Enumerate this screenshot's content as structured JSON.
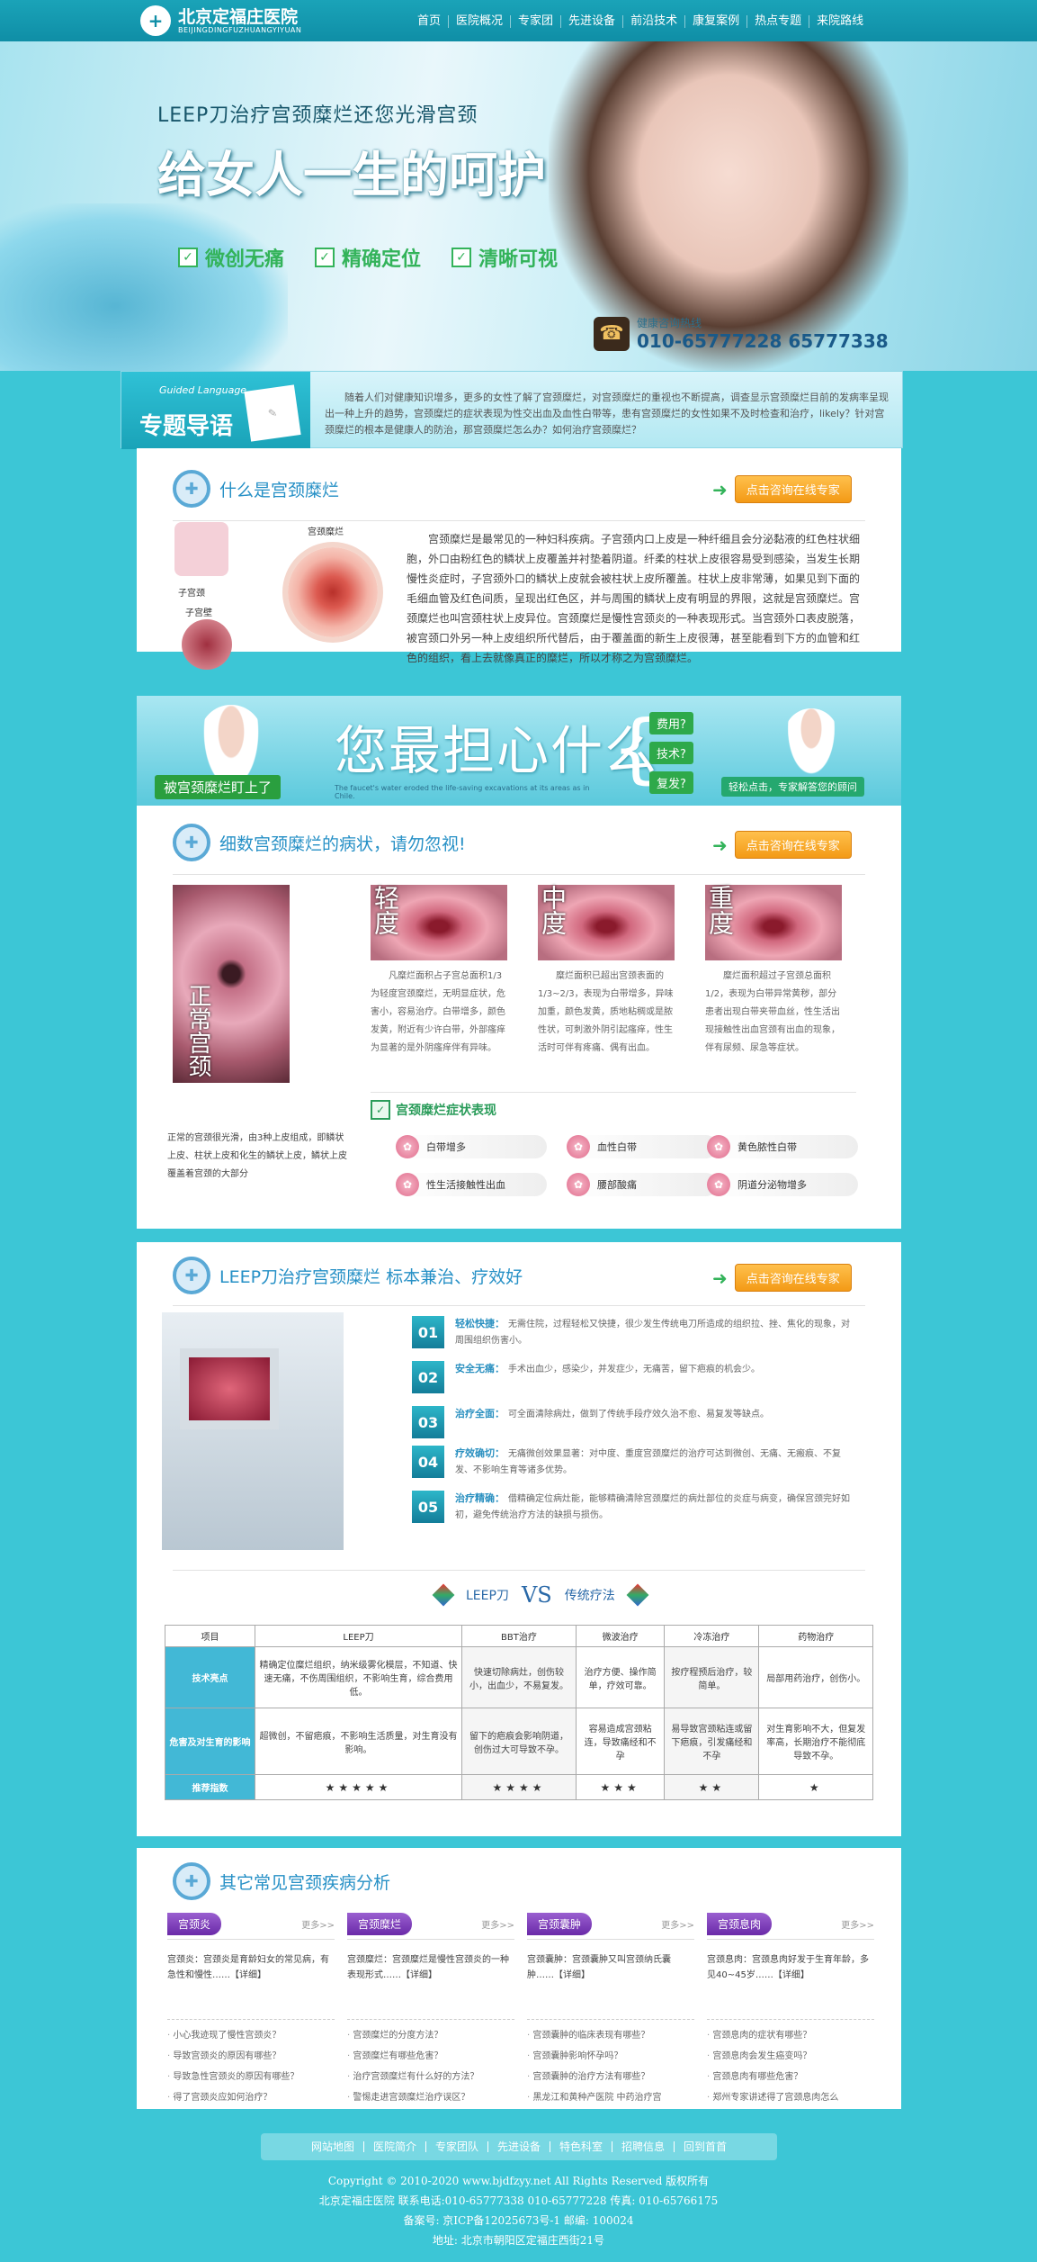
{
  "header": {
    "logo_mark": "+",
    "logo_cn": "北京定福庄医院",
    "logo_py": "BEIJINGDINGFUZHUANGYIYUAN",
    "nav": [
      "首页",
      "医院概况",
      "专家团",
      "先进设备",
      "前沿技术",
      "康复案例",
      "热点专题",
      "来院路线"
    ]
  },
  "banner": {
    "subtitle": "LEEP刀治疗宫颈糜烂还您光滑宫颈",
    "title": "给女人一生的呵护",
    "features": [
      "微创无痛",
      "精确定位",
      "清晰可视"
    ],
    "hotline_label": "健康咨询热线",
    "hotline": "010-65777228 65777338"
  },
  "intro": {
    "en": "Guided Language",
    "cn": "专题导语",
    "text": "随着人们对健康知识增多，更多的女性了解了宫颈糜烂，对宫颈糜烂的重视也不断提高，调查显示宫颈糜烂目前的发病率呈现出一种上升的趋势，宫颈糜烂的症状表现为性交出血及血性白带等，患有宫颈糜烂的女性如果不及时检查和治疗，likely？针对宫颈糜烂的根本是健康人的防治，那宫颈糜烂怎么办？如何治疗宫颈糜烂？"
  },
  "section1": {
    "title": "什么是宫颈糜烂",
    "consult": "点击咨询在线专家",
    "labels": {
      "erosion": "宫颈糜烂",
      "uterus": "子宫颈",
      "wall": "子宫壁"
    },
    "text": "宫颈糜烂是最常见的一种妇科疾病。子宫颈内口上皮是一种纤细且会分泌黏液的红色柱状细胞，外口由粉红色的鳞状上皮覆盖并衬垫着阴道。纤柔的柱状上皮很容易受到感染，当发生长期慢性炎症时，子宫颈外口的鳞状上皮就会被柱状上皮所覆盖。柱状上皮非常薄，如果见到下面的毛细血管及红色间质，呈现出红色区，并与周围的鳞状上皮有明显的界限，这就是宫颈糜烂。宫颈糜烂也叫宫颈柱状上皮异位。宫颈糜烂是慢性宫颈炎的一种表现形式。当宫颈外口表皮脱落，被宫颈口外另一种上皮组织所代替后，由于覆盖面的新生上皮很薄，甚至能看到下方的血管和红色的组织，看上去就像真正的糜烂，所以才称之为宫颈糜烂。"
  },
  "worry": {
    "tag": "被宫颈糜烂盯上了",
    "big": "您最担心什么",
    "small": "The faucet's water eroded the life-saving excavations at its areas as in Chile.",
    "opts": [
      "费用?",
      "技术?",
      "复发?"
    ],
    "ask": "轻松点击，专家解答您的顾问"
  },
  "section2": {
    "title": "细数宫颈糜烂的病状，请勿忽视!",
    "consult": "点击咨询在线专家",
    "normal_label": "正常宫颈",
    "normal_text": "正常的宫颈很光滑，由3种上皮组成，即鳞状上皮、柱状上皮和化生的鳞状上皮，鳞状上皮覆盖着宫颈的大部分",
    "stages": [
      {
        "label": "轻度",
        "text": "凡糜烂面积占子宫总面积1/3为轻度宫颈糜烂，无明显症状，危害小，容易治疗。白带增多，颜色发黄，附近有少许白带，外部瘙痒为显著的是外阴瘙痒伴有异味。"
      },
      {
        "label": "中度",
        "text": "糜烂面积已超出宫颈表面的1/3~2/3，表现为白带增多，异味加重，颜色发黄，质地粘稠或是脓性状，可刺激外阴引起瘙痒，性生活时可伴有疼痛、偶有出血。"
      },
      {
        "label": "重度",
        "text": "糜烂面积超过子宫颈总面积1/2，表现为白带异常黄秽，部分患者出现白带夹带血丝，性生活出现接触性出血宫颈有出血的现象，伴有尿频、尿急等症状。"
      }
    ],
    "symptoms_title": "宫颈糜烂症状表现",
    "symptoms": [
      "白带增多",
      "血性白带",
      "黄色脓性白带",
      "性生活接触性出血",
      "腰部酸痛",
      "阴道分泌物增多"
    ]
  },
  "section3": {
    "title": "LEEP刀治疗宫颈糜烂 标本兼治、疗效好",
    "consult": "点击咨询在线专家",
    "features": [
      {
        "n": "01",
        "title": "轻松快捷：",
        "text": "无需住院，过程轻松又快捷，很少发生传统电刀所造成的组织拉、挫、焦化的现象，对周围组织伤害小。"
      },
      {
        "n": "02",
        "title": "安全无痛：",
        "text": "手术出血少，感染少，并发症少，无痛苦，留下疤痕的机会少。"
      },
      {
        "n": "03",
        "title": "治疗全面：",
        "text": "可全面清除病灶，做到了传统手段疗效久治不愈、易复发等缺点。"
      },
      {
        "n": "04",
        "title": "疗效确切：",
        "text": "无痛微创效果显著：对中度、重度宫颈糜烂的治疗可达到微创、无痛、无瘢痕、不复发、不影响生育等诸多优势。"
      },
      {
        "n": "05",
        "title": "治疗精确：",
        "text": "借精确定位病灶能，能够精确清除宫颈糜烂的病灶部位的炎症与病变，确保宫颈完好如初，避免传统治疗方法的缺损与损伤。"
      }
    ],
    "vs": {
      "left": "LEEP刀",
      "mid": "VS",
      "right": "传统疗法"
    },
    "table": {
      "header": [
        "项目",
        "LEEP刀",
        "BBT治疗",
        "微波治疗",
        "冷冻治疗",
        "药物治疗"
      ],
      "rows": [
        {
          "label": "技术亮点",
          "cells": [
            "精确定位糜烂组织，纳米级雾化模层，不知道、快速无痛，不伤周围组织，不影响生育，综合费用低。",
            "快速切除病灶，创伤较小，出血少，不易复发。",
            "治疗方便、操作简单，疗效可靠。",
            "按疗程预后治疗，较简单。",
            "局部用药治疗，创伤小。"
          ]
        },
        {
          "label": "危害及对生育的影响",
          "cells": [
            "超微创，不留疤痕，不影响生活质量，对生育没有影响。",
            "留下的疤痕会影响阴道，创伤过大可导致不孕。",
            "容易造成宫颈粘连，导致痛经和不孕",
            "易导致宫颈粘连或留下疤痕，引发痛经和不孕",
            "对生育影响不大，但复发率高，长期治疗不能彻底导致不孕。"
          ]
        },
        {
          "label": "推荐指数",
          "cells": [
            "★★★★★",
            "★★★★",
            "★★★",
            "★★",
            "★"
          ]
        }
      ]
    }
  },
  "section4": {
    "title": "其它常见宫颈疾病分析",
    "more": "更多>>",
    "cols": [
      {
        "tab": "宫颈炎",
        "desc": "宫颈炎：宫颈炎是育龄妇女的常见病，有急性和慢性……【详细】",
        "items": [
          "小心我迹现了慢性宫颈炎？",
          "导致宫颈炎的原因有哪些？",
          "导致急性宫颈炎的原因有哪些？",
          "得了宫颈炎应如何治疗？"
        ]
      },
      {
        "tab": "宫颈糜烂",
        "desc": "宫颈糜烂：宫颈糜烂是慢性宫颈炎的一种表现形式……【详细】",
        "items": [
          "宫颈糜烂的分度方法？",
          "宫颈糜烂有哪些危害？",
          "治疗宫颈糜烂有什么好的方法？",
          "警惕走进宫颈糜烂治疗误区？"
        ]
      },
      {
        "tab": "宫颈囊肿",
        "desc": "宫颈囊肿：宫颈囊肿又叫宫颈纳氏囊肿……【详细】",
        "items": [
          "宫颈囊肿的临床表现有哪些？",
          "宫颈囊肿影响怀孕吗？",
          "宫颈囊肿的治疗方法有哪些？",
          "黑龙江和黄种产医院   中药治疗宫"
        ]
      },
      {
        "tab": "宫颈息肉",
        "desc": "宫颈息肉：宫颈息肉好发于生育年龄，多见40~45岁……【详细】",
        "items": [
          "宫颈息肉的症状有哪些？",
          "宫颈息肉会发生癌变吗？",
          "宫颈息肉有哪些危害？",
          "郑州专家讲述得了宫颈息肉怎么"
        ]
      }
    ]
  },
  "footer": {
    "nav": [
      "网站地图",
      "医院简介",
      "专家团队",
      "先进设备",
      "特色科室",
      "招聘信息",
      "回到首首"
    ],
    "lines": [
      "Copyright © 2010-2020   www.bjdfzyy.net   All Rights Reserved 版权所有",
      "北京定福庄医院  联系电话:010-65777338 010-65777228     传真: 010-65766175",
      "备案号: 京ICP备12025673号-1     邮编: 100024",
      "地址: 北京市朝阳区定福庄西街21号"
    ]
  }
}
